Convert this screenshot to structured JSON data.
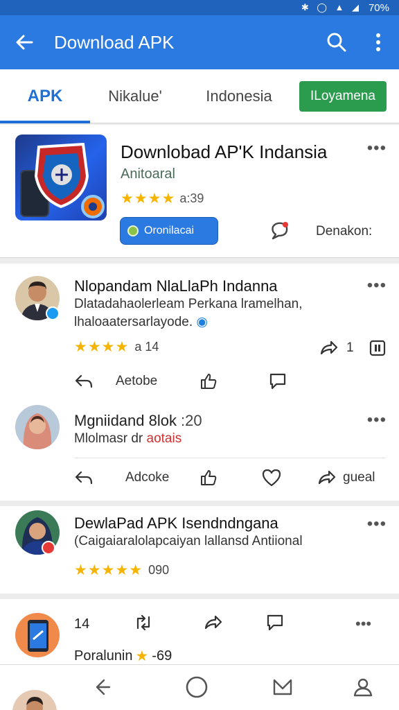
{
  "status_bar": {
    "battery": "70%"
  },
  "app_bar": {
    "title": "Download APK"
  },
  "tabs": [
    {
      "label": "APK",
      "active": true
    },
    {
      "label": "Nikalue'"
    },
    {
      "label": "Indonesia"
    },
    {
      "label": "ILoyamena"
    }
  ],
  "app": {
    "name": "Downlobad AP'K Indansia",
    "developer": "Anitoaral",
    "rating_text": "a:39",
    "install_label": "Oronilacai",
    "share_label": "Denakon:"
  },
  "posts": [
    {
      "name": "Nlopandam NlaLlaPh Indanna",
      "text_line1": "Dlatadahaolerleam Perkana lramelhan,",
      "text_line2": "lhaloaatersarlayode.",
      "rating_text": "a 14",
      "share_count": "1",
      "reply_label": "Aetobe"
    },
    {
      "name": "Mgniidand 8lok",
      "time": ":20",
      "text_prefix": "Mlolmasr dr",
      "text_highlight": "aotais",
      "reply_label": "Adcoke",
      "share_label": "gueal"
    },
    {
      "name": "DewlaPad APK Isendndngana",
      "text": "(Caigaiaralolapcaiyan lallansd Antiional",
      "rating_text": "090"
    },
    {
      "count": "14",
      "name": "Poralunin",
      "rating_text": "-69"
    }
  ],
  "colors": {
    "primary": "#2a7ae2",
    "status_bar": "#1f63bd",
    "tab_pill": "#2b9b4e",
    "star": "#f5b400"
  }
}
